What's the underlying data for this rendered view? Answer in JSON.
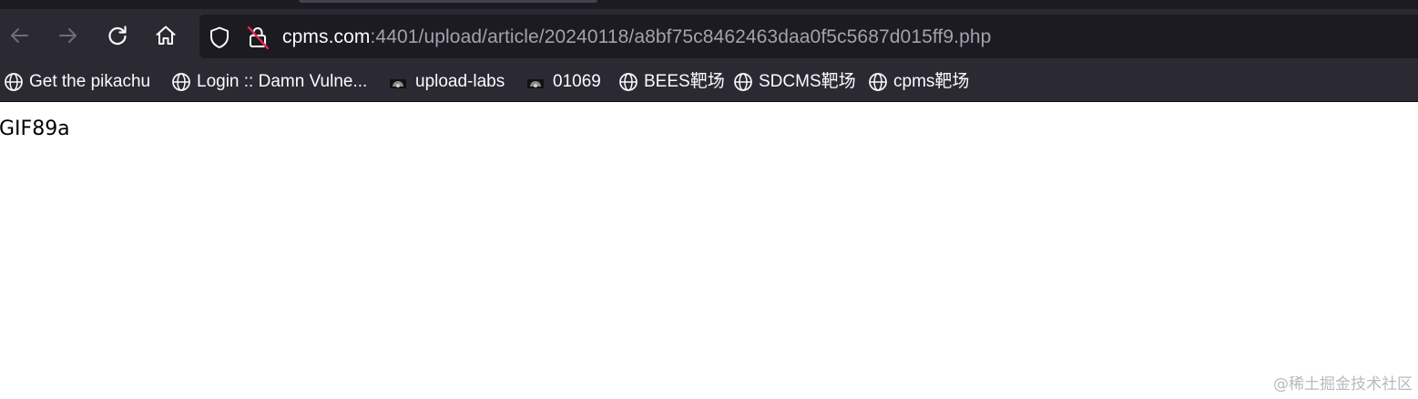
{
  "toolbar": {
    "back_icon": "arrow-left-icon",
    "forward_icon": "arrow-right-icon",
    "reload_icon": "reload-icon",
    "home_icon": "home-icon"
  },
  "urlbar": {
    "host": "cpms.com",
    "rest": ":4401/upload/article/20240118/a8bf75c8462463daa0f5c5687d015ff9.php",
    "tracking_icon": "shield-icon",
    "security_icon": "insecure-lock-icon"
  },
  "bookmarks": [
    {
      "label": "Get the pikachu",
      "icon": "globe-icon"
    },
    {
      "label": "Login :: Damn Vulne...",
      "icon": "globe-icon"
    },
    {
      "label": "upload-labs",
      "icon": "site-favicon"
    },
    {
      "label": "01069",
      "icon": "site-favicon"
    },
    {
      "label": "BEES靶场",
      "icon": "globe-icon"
    },
    {
      "label": "SDCMS靶场",
      "icon": "globe-icon"
    },
    {
      "label": "cpms靶场",
      "icon": "globe-icon"
    }
  ],
  "page": {
    "body_text": "GIF89a",
    "watermark": "@稀土掘金技术社区"
  },
  "colors": {
    "chrome_bg": "#2b2a33",
    "urlbar_bg": "#1c1b22",
    "text_primary": "#fbfbfe",
    "text_secondary": "#a3a2ad",
    "insecure_strike": "#e22850"
  }
}
